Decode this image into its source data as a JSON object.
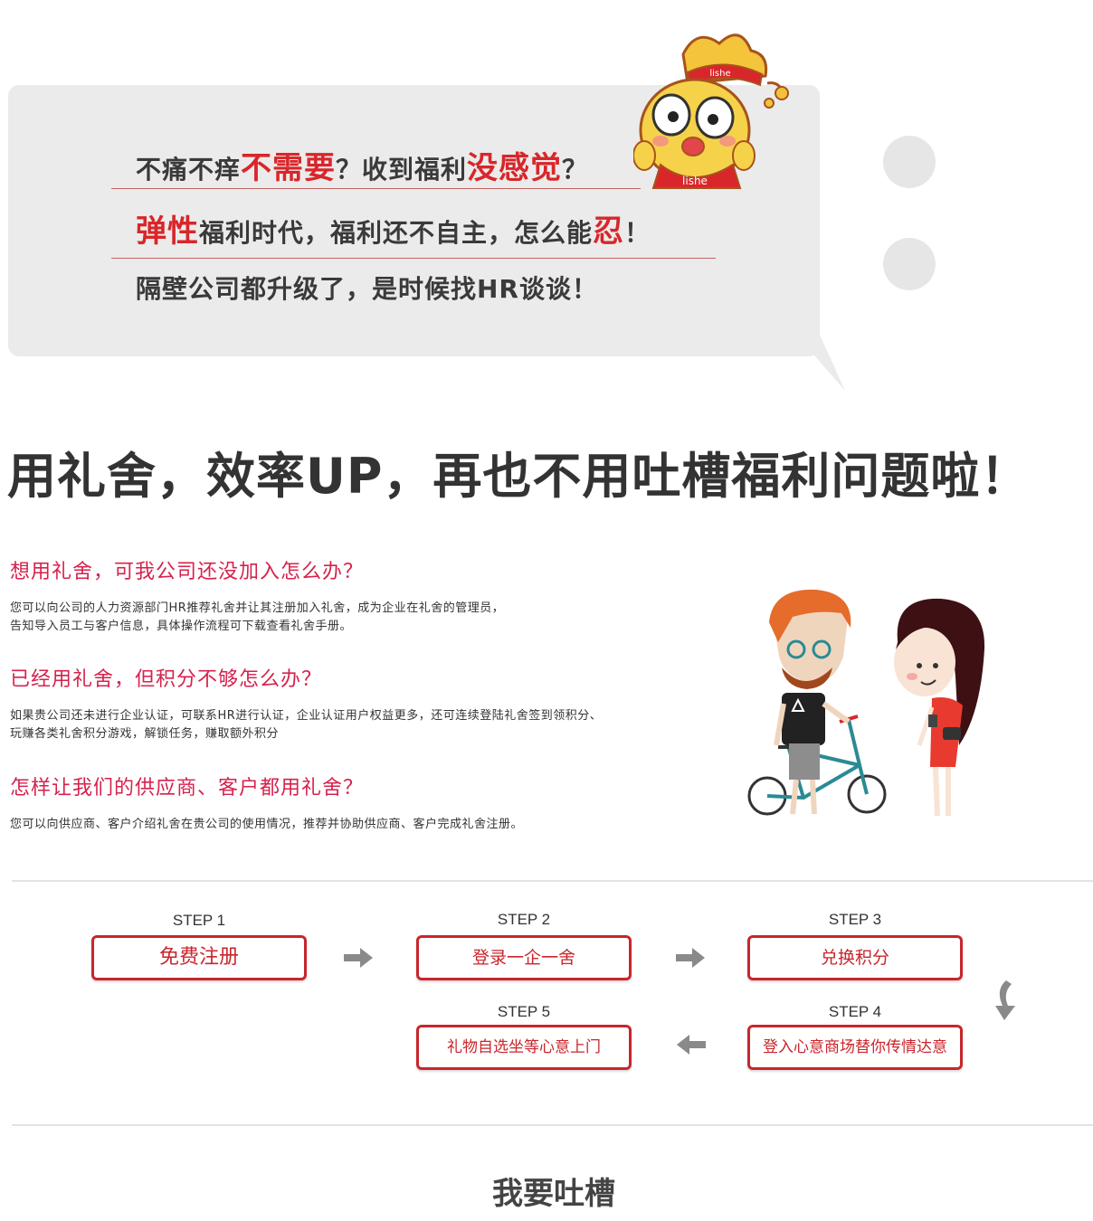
{
  "banner": {
    "line1": [
      {
        "text": "不痛不痒",
        "red": false
      },
      {
        "text": "不需要",
        "red": true
      },
      {
        "text": "？收到福利",
        "red": false
      },
      {
        "text": "没感觉",
        "red": true
      },
      {
        "text": "？",
        "red": false
      }
    ],
    "line2": [
      {
        "text": "弹性",
        "red": true
      },
      {
        "text": "福利时代，福利还不自主，怎么能",
        "red": false
      },
      {
        "text": "忍",
        "red": true
      },
      {
        "text": "！",
        "red": false
      }
    ],
    "line3": "隔壁公司都升级了，是时候找HR谈谈！",
    "mascot_badge": "lishe",
    "mascot_shirt": "lishe"
  },
  "headline": "用礼舍，效率UP，再也不用吐槽福利问题啦！",
  "faq": [
    {
      "question": "想用礼舍，可我公司还没加入怎么办？",
      "answer": [
        "您可以向公司的人力资源部门HR推荐礼舍并让其注册加入礼舍，成为企业在礼舍的管理员，",
        "告知导入员工与客户信息，具体操作流程可下载查看礼舍手册。"
      ]
    },
    {
      "question": "已经用礼舍，但积分不够怎么办？",
      "answer": [
        "如果贵公司还未进行企业认证，可联系HR进行认证，企业认证用户权益更多，还可连续登陆礼舍签到领积分、",
        "玩赚各类礼舍积分游戏，解锁任务，赚取额外积分"
      ]
    },
    {
      "question": "怎样让我们的供应商、客户都用礼舍？",
      "answer": [
        "您可以向供应商、客户介绍礼舍在贵公司的使用情况，推荐并协助供应商、客户完成礼舍注册。"
      ]
    }
  ],
  "steps": [
    {
      "label": "STEP 1",
      "action": "免费注册"
    },
    {
      "label": "STEP 2",
      "action": "登录一企一舍"
    },
    {
      "label": "STEP 3",
      "action": "兑换积分"
    },
    {
      "label": "STEP 4",
      "action": "登入心意商场替你传情达意"
    },
    {
      "label": "STEP 5",
      "action": "礼物自选坐等心意上门"
    }
  ],
  "complain_title": "我要吐槽",
  "colors": {
    "accent_red": "#d9262a",
    "question_pink": "#d6224d",
    "button_border": "#c8262c",
    "bubble_gray": "#ebebeb",
    "arrow_gray": "#8a8a8a"
  }
}
